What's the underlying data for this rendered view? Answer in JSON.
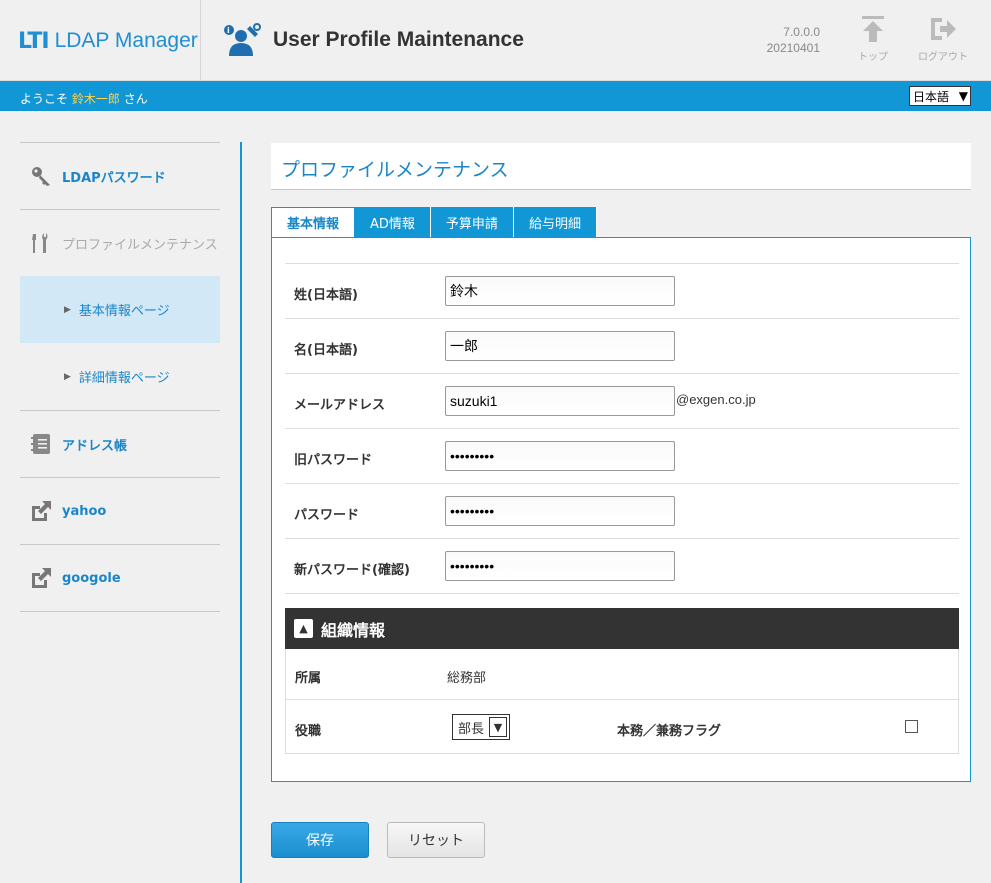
{
  "header": {
    "logo_mark": "LTI",
    "logo_text": "LDAP Manager",
    "page_title": "User Profile Maintenance",
    "version": "7.0.0.0",
    "build": "20210401",
    "top_label": "トップ",
    "logout_label": "ログアウト"
  },
  "welcome": {
    "prefix": "ようこそ",
    "user": "鈴木一郎",
    "suffix": "さん",
    "language": "日本語"
  },
  "sidebar": {
    "items": [
      {
        "label": "LDAPパスワード",
        "icon": "key-icon"
      },
      {
        "label": "プロファイルメンテナンス",
        "icon": "tools-icon"
      },
      {
        "label": "アドレス帳",
        "icon": "address-book-icon"
      },
      {
        "label": "yahoo",
        "icon": "external-link-icon"
      },
      {
        "label": "googole",
        "icon": "external-link-icon"
      }
    ],
    "subitems": [
      {
        "label": "基本情報ページ",
        "active": true
      },
      {
        "label": "詳細情報ページ",
        "active": false
      }
    ]
  },
  "main": {
    "section_title": "プロファイルメンテナンス",
    "tabs": [
      {
        "label": "基本情報",
        "active": true
      },
      {
        "label": "AD情報",
        "active": false
      },
      {
        "label": "予算申請",
        "active": false
      },
      {
        "label": "給与明細",
        "active": false
      }
    ],
    "fields": [
      {
        "label": "姓(日本語)",
        "value": "鈴木",
        "type": "text"
      },
      {
        "label": "名(日本語)",
        "value": "一郎",
        "type": "text"
      },
      {
        "label": "メールアドレス",
        "value": "suzuki1",
        "type": "text",
        "suffix": "@exgen.co.jp"
      },
      {
        "label": "旧パスワード",
        "value": "•••••••••",
        "type": "password"
      },
      {
        "label": "パスワード",
        "value": "•••••••••",
        "type": "password"
      },
      {
        "label": "新パスワード(確認)",
        "value": "•••••••••",
        "type": "password"
      }
    ],
    "org": {
      "title": "組織情報",
      "department_label": "所属",
      "department_value": "総務部",
      "position_label": "役職",
      "position_value": "部長",
      "flag_label": "本務／兼務フラグ",
      "flag_checked": false
    },
    "save_label": "保存",
    "reset_label": "リセット"
  },
  "colors": {
    "accent": "#1196d6",
    "link": "#1a86c8",
    "dark_header": "#333333"
  }
}
